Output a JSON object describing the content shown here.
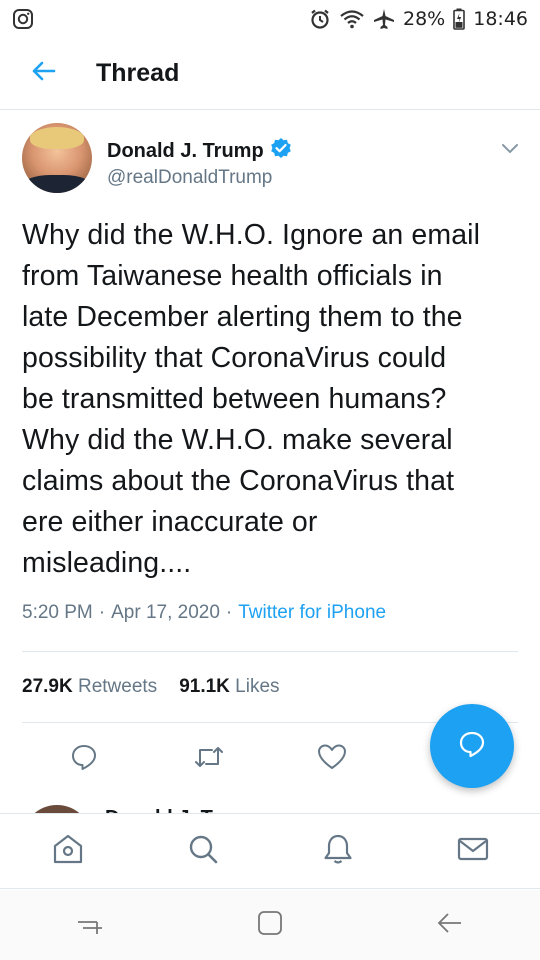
{
  "status_bar": {
    "battery": "28%",
    "time": "18:46",
    "icons": [
      "instagram-icon",
      "alarm-icon",
      "wifi-icon",
      "airplane-icon",
      "battery-icon"
    ]
  },
  "header": {
    "title": "Thread",
    "back_icon": "arrow-left-icon"
  },
  "tweet": {
    "author_name": "Donald J. Trump",
    "handle": "@realDonaldTrump",
    "verified": true,
    "text": "Why did the W.H.O. Ignore an email\nfrom Taiwanese health officials in\nlate December alerting them to the\npossibility that CoronaVirus could\nbe transmitted between humans?\nWhy did the W.H.O. make several\nclaims about the CoronaVirus that\nere either inaccurate or\nmisleading....",
    "time": "5:20 PM",
    "date": "Apr 17, 2020",
    "separator": "·",
    "source": "Twitter for iPhone",
    "retweets_count": "27.9K",
    "retweets_label": "Retweets",
    "likes_count": "91.1K",
    "likes_label": "Likes"
  },
  "actions": [
    "reply-icon",
    "retweet-icon",
    "like-icon",
    "share-icon"
  ],
  "next_tweet": {
    "author_name": "Donald J. Trump"
  },
  "bottom_nav": [
    "home-icon",
    "search-icon",
    "notifications-icon",
    "messages-icon"
  ],
  "system_nav": [
    "recents-icon",
    "home-square-icon",
    "back-icon"
  ],
  "colors": {
    "accent": "#1da1f2",
    "text": "#14171a",
    "secondary": "#657786",
    "divider": "#e1e8ed"
  }
}
